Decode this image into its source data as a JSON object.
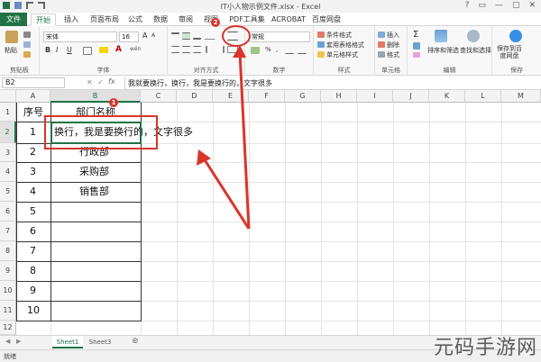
{
  "window": {
    "title": "IT小人物示例文件.xlsx - Excel",
    "controls": [
      "?",
      "▭",
      "—",
      "▢",
      "✕"
    ]
  },
  "tabs": [
    {
      "label": "文件",
      "kind": "file"
    },
    {
      "label": "开始",
      "kind": "active"
    },
    {
      "label": "插入"
    },
    {
      "label": "页面布局"
    },
    {
      "label": "公式"
    },
    {
      "label": "数据"
    },
    {
      "label": "审阅"
    },
    {
      "label": "视图"
    },
    {
      "label": "PDF工具集"
    },
    {
      "label": "ACROBAT"
    },
    {
      "label": "百度网盘"
    }
  ],
  "ribbon": {
    "clipboard": {
      "paste": "粘贴",
      "label": "剪贴板"
    },
    "font": {
      "name": "宋体",
      "size": "16",
      "bold": "B",
      "italic": "I",
      "underline": "U",
      "grow": "A",
      "shrink": "A",
      "wen": "wén",
      "label": "字体"
    },
    "alignment": {
      "label": "对齐方式"
    },
    "number": {
      "format": "常规",
      "label": "数字"
    },
    "styles": {
      "conditional": "条件格式",
      "table": "套用表格格式",
      "cell": "单元格样式",
      "label": "样式"
    },
    "cells": {
      "insert": "插入",
      "delete": "删除",
      "format": "格式",
      "label": "单元格"
    },
    "editing": {
      "sort": "排序和筛选",
      "find": "查找和选择",
      "label": "编辑"
    },
    "save": {
      "button": "保存到百度网盘",
      "label": "保存"
    }
  },
  "formula_bar": {
    "name_box": "B2",
    "fx": "fx",
    "formula": "我就要换行，换行，我是要换行的，文字很多"
  },
  "columns": [
    "A",
    "B",
    "C",
    "D",
    "E",
    "F",
    "G",
    "H",
    "I",
    "J",
    "K",
    "L",
    "M"
  ],
  "rows": [
    "1",
    "2",
    "3",
    "4",
    "5",
    "6",
    "7",
    "8",
    "9",
    "10",
    "11",
    "12"
  ],
  "cells": {
    "a1": "序号",
    "b1": "部门名称",
    "a2": "1",
    "b2_overflow": "换行，我是要换行的，文字很多",
    "a3": "2",
    "b3": "行政部",
    "a4": "3",
    "b4": "采购部",
    "a5": "4",
    "b5": "销售部",
    "a6": "5",
    "a7": "6",
    "a8": "7",
    "a9": "8",
    "a10": "9",
    "a11": "10"
  },
  "badges": {
    "cell": "1",
    "ribbon": "2"
  },
  "sheets": [
    {
      "label": "Sheet1",
      "active": true
    },
    {
      "label": "Sheet3"
    }
  ],
  "status": {
    "ready": "就绪"
  },
  "watermark": "元码手游网",
  "colors": {
    "excel_green": "#217346",
    "annotation_red": "#d9352b"
  }
}
